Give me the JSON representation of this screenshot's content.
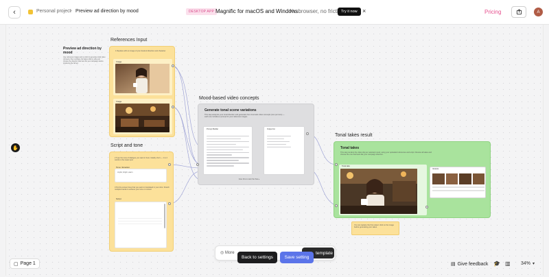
{
  "topbar": {
    "back_icon": "chevron-left-icon",
    "breadcrumb_parent": "Personal project",
    "breadcrumb_separator": ">",
    "breadcrumb_current": "Preview ad direction by mood",
    "promo_badge": "DESKTOP APP",
    "promo_title": "Magnific for macOS and Windows",
    "promo_subtitle": "No browser, no friction",
    "promo_button": "Try it now",
    "promo_close": "×",
    "pricing": "Pricing",
    "share_icon": "share-icon",
    "avatar_initial": "A",
    "accent_color": "#e64e8d"
  },
  "canvas": {
    "hand_icon": "hand-icon",
    "note": {
      "title": "Preview ad direction by mood",
      "body": "Use reference images and a script to generate tonal video concepts, then compare the takes side by side and choose the direction that best fits your campaign before producing the full ad."
    },
    "references": {
      "label": "References Input",
      "instruction": "1  Replace with an image of your desired direction and character",
      "tag_1": "Image",
      "tag_2": "Image"
    },
    "script": {
      "label": "Script and tone",
      "step_1": "2  Type the tone of dialogue you want in here. Ideally short — 1 to 2 words is the sweet spot",
      "field_1_label": "Tone / Emotion",
      "field_1_value": "Joyful, bright, warm",
      "step_2": "3  Put the screen lines that you want to translated in your shot. Stretch multiple brands to achieve your tone or context",
      "field_2_label": "Script"
    },
    "mood": {
      "label": "Mood-based video concepts",
      "title": "Generate tonal scene variations",
      "description": "This step analyzes your tonal direction and generates four cinematic video concepts (one per tone) — each one includes a prompt for your reference images.",
      "left_panel_title": "Prompt Builder",
      "right_panel_title": "Output list",
      "footer": "Give this to start the flow ▸"
    },
    "tonal": {
      "label": "Tonal takes result",
      "title": "Tonal takes",
      "description": "This step renders the video clip per selected mood, using your uploaded references and script. Review all takes and choose the one that feels like your campaign direction.",
      "main_tag": "Tonal take",
      "list_tag": "Variants"
    },
    "hint": "You can replace the first output: click on the image before generating your takes."
  },
  "bottom": {
    "page_label": "Page 1",
    "page_icon": "page-icon",
    "dock_more": "More",
    "dock_template": "template",
    "back_button": "Back to settings",
    "save_button": "Save setting",
    "save_color": "#5b74e9",
    "feedback": "Give feedback",
    "feedback_icon": "message-icon",
    "grad_icon": "graduation-cap-icon",
    "map_icon": "map-icon",
    "zoom": "34%"
  }
}
